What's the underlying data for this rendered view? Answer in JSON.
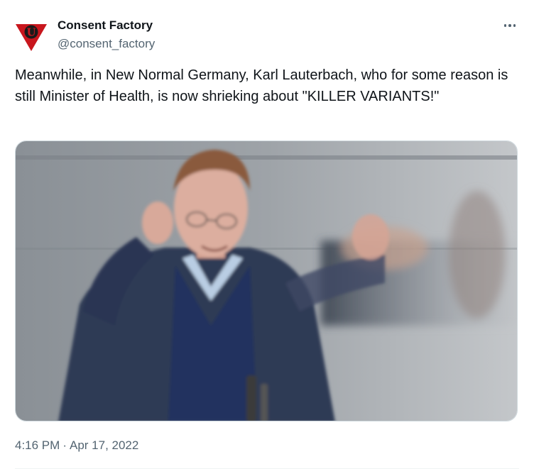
{
  "author": {
    "display_name": "Consent Factory",
    "handle": "@consent_factory",
    "avatar_letter": "U",
    "avatar_colors": {
      "triangle": "#c8161d",
      "circle": "#1a1a1a",
      "letter": "#c8161d"
    }
  },
  "tweet": {
    "text": "Meanwhile, in New Normal Germany, Karl Lauterbach, who for some reason is still Minister of Health, is now shrieking about \"KILLER VARIANTS!\""
  },
  "meta": {
    "time": "4:16 PM",
    "separator": "·",
    "date": "Apr 17, 2022"
  },
  "icons": {
    "more": "more-horizontal-icon"
  },
  "colors": {
    "text": "#0f1419",
    "secondary": "#536471",
    "border": "#cfd9de"
  }
}
